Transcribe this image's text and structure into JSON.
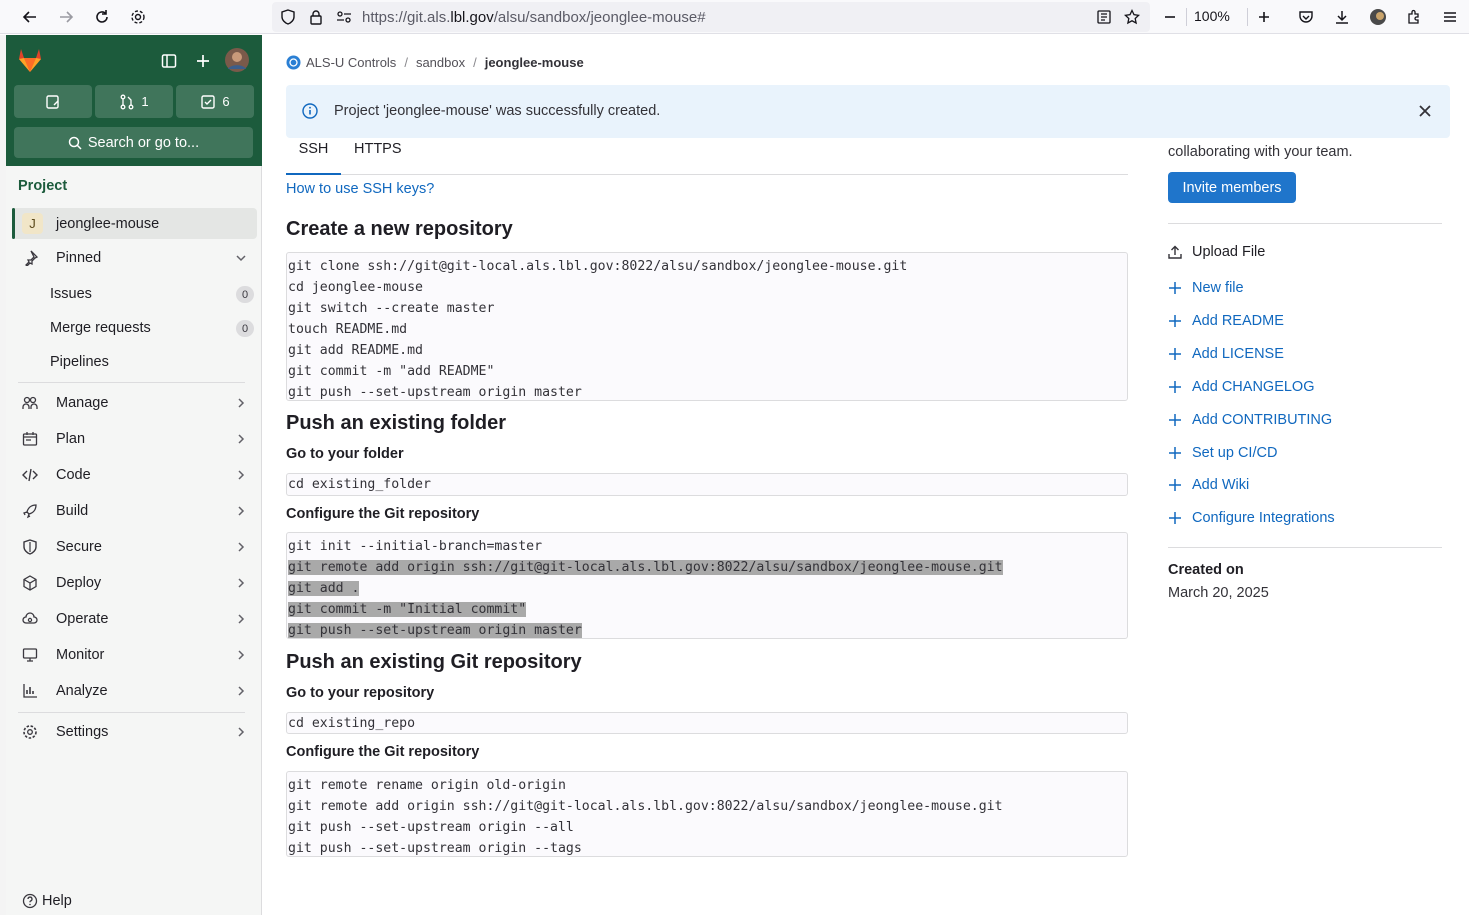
{
  "browser": {
    "url_prefix": "https://git.als.",
    "url_domain": "lbl.gov",
    "url_path": "/alsu/sandbox/jeonglee-mouse#",
    "zoom": "100%"
  },
  "sidebar": {
    "merge_requests_count": "1",
    "todos_count": "6",
    "search_label": "Search or go to...",
    "section_label": "Project",
    "project_initial": "J",
    "project_name": "jeonglee-mouse",
    "pinned_label": "Pinned",
    "pinned_items": [
      {
        "label": "Issues",
        "count": "0"
      },
      {
        "label": "Merge requests",
        "count": "0"
      },
      {
        "label": "Pipelines"
      }
    ],
    "nav_items": [
      {
        "label": "Manage",
        "icon": "users-icon"
      },
      {
        "label": "Plan",
        "icon": "calendar-icon"
      },
      {
        "label": "Code",
        "icon": "code-icon"
      },
      {
        "label": "Build",
        "icon": "rocket-icon"
      },
      {
        "label": "Secure",
        "icon": "shield-icon"
      },
      {
        "label": "Deploy",
        "icon": "deployments-icon"
      },
      {
        "label": "Operate",
        "icon": "cloud-gear-icon"
      },
      {
        "label": "Monitor",
        "icon": "monitor-icon"
      },
      {
        "label": "Analyze",
        "icon": "chart-icon"
      }
    ],
    "settings_label": "Settings",
    "help_label": "Help"
  },
  "breadcrumb": {
    "group": "ALS-U Controls",
    "subgroup": "sandbox",
    "project": "jeonglee-mouse"
  },
  "alert": {
    "message": "Project 'jeonglee-mouse' was successfully created."
  },
  "tabs": [
    "SSH",
    "HTTPS"
  ],
  "ssh_help_link": "How to use SSH keys?",
  "sections": {
    "new_repo_title": "Create a new repository",
    "new_repo_code": [
      "git clone ssh://git@git-local.als.lbl.gov:8022/alsu/sandbox/jeonglee-mouse.git",
      "cd jeonglee-mouse",
      "git switch --create master",
      "touch README.md",
      "git add README.md",
      "git commit -m \"add README\"",
      "git push --set-upstream origin master"
    ],
    "push_folder_title": "Push an existing folder",
    "go_to_folder": "Go to your folder",
    "folder_code": [
      "cd existing_folder"
    ],
    "configure_git_1": "Configure the Git repository",
    "folder_config_code": [
      "git init --initial-branch=master",
      "git remote add origin ssh://git@git-local.als.lbl.gov:8022/alsu/sandbox/jeonglee-mouse.git",
      "git add .",
      "git commit -m \"Initial commit\"",
      "git push --set-upstream origin master"
    ],
    "push_repo_title": "Push an existing Git repository",
    "go_to_repo": "Go to your repository",
    "repo_code": [
      "cd existing_repo"
    ],
    "configure_git_2": "Configure the Git repository",
    "repo_config_code": [
      "git remote rename origin old-origin",
      "git remote add origin ssh://git@git-local.als.lbl.gov:8022/alsu/sandbox/jeonglee-mouse.git",
      "git push --set-upstream origin --all",
      "git push --set-upstream origin --tags"
    ]
  },
  "right_panel": {
    "partial_text": "collaborating with your team.",
    "invite_label": "Invite members",
    "upload_label": "Upload File",
    "links": [
      "New file",
      "Add README",
      "Add LICENSE",
      "Add CHANGELOG",
      "Add CONTRIBUTING",
      "Set up CI/CD",
      "Add Wiki",
      "Configure Integrations"
    ],
    "created_label": "Created on",
    "created_date": "March 20, 2025"
  },
  "colors": {
    "sidebar_header": "#1c5b3c",
    "link": "#1068bf",
    "primary_button": "#1f75cb",
    "alert_bg": "#e9f3fc"
  }
}
